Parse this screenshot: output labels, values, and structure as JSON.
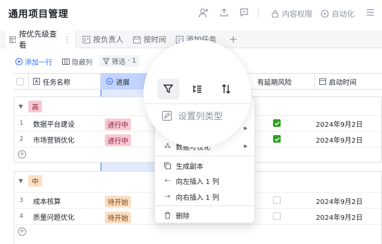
{
  "header": {
    "title": "通用项目管理",
    "permission_label": "内容权限",
    "automation_label": "自动化"
  },
  "views": [
    {
      "label": "按优先级查看",
      "icon": "table-icon"
    },
    {
      "label": "按负责人",
      "icon": "kanban-icon"
    },
    {
      "label": "按时间",
      "icon": "calendar-icon"
    },
    {
      "label": "添加任务",
      "icon": "form-icon"
    }
  ],
  "toolbar": {
    "add_row": "添加一行",
    "hide_columns": "隐藏列",
    "filter": "筛选",
    "filter_count": "1"
  },
  "columns": {
    "task_name": "任务名称",
    "progress": "进展",
    "delay_risk": "有延期风险",
    "start_time": "启动时间"
  },
  "groups": [
    {
      "label": "高",
      "tag_bg": "#f8c8d2",
      "tag_fg": "#8a1f3a",
      "rows": [
        {
          "num": "1",
          "name": "数据平台建设",
          "status": "进行中",
          "risk": true,
          "date": "2024年9月2日"
        },
        {
          "num": "2",
          "name": "市场营销优化",
          "status": "进行中",
          "risk": true,
          "date": "2024年9月2日"
        }
      ]
    },
    {
      "label": "中",
      "tag_bg": "#fbdfc4",
      "tag_fg": "#7a4512",
      "rows": [
        {
          "num": "3",
          "name": "成本核算",
          "status": "待开始",
          "risk": false,
          "date": "2024年9月2日"
        },
        {
          "num": "4",
          "name": "质量问题优化",
          "status": "待开始",
          "risk": false,
          "date": "2024年9月2日"
        }
      ]
    }
  ],
  "context_menu": {
    "visualize": "数据可视化",
    "duplicate": "生成副本",
    "insert_left": "向左插入 1 列",
    "insert_right": "向右插入 1 列",
    "delete": "删除"
  },
  "magnifier": {
    "set_column_type": "设置列类型"
  },
  "colors": {
    "accent": "#3370ff",
    "progress_column_bg": "#e1eaff",
    "checkbox_on": "#2ea121"
  }
}
